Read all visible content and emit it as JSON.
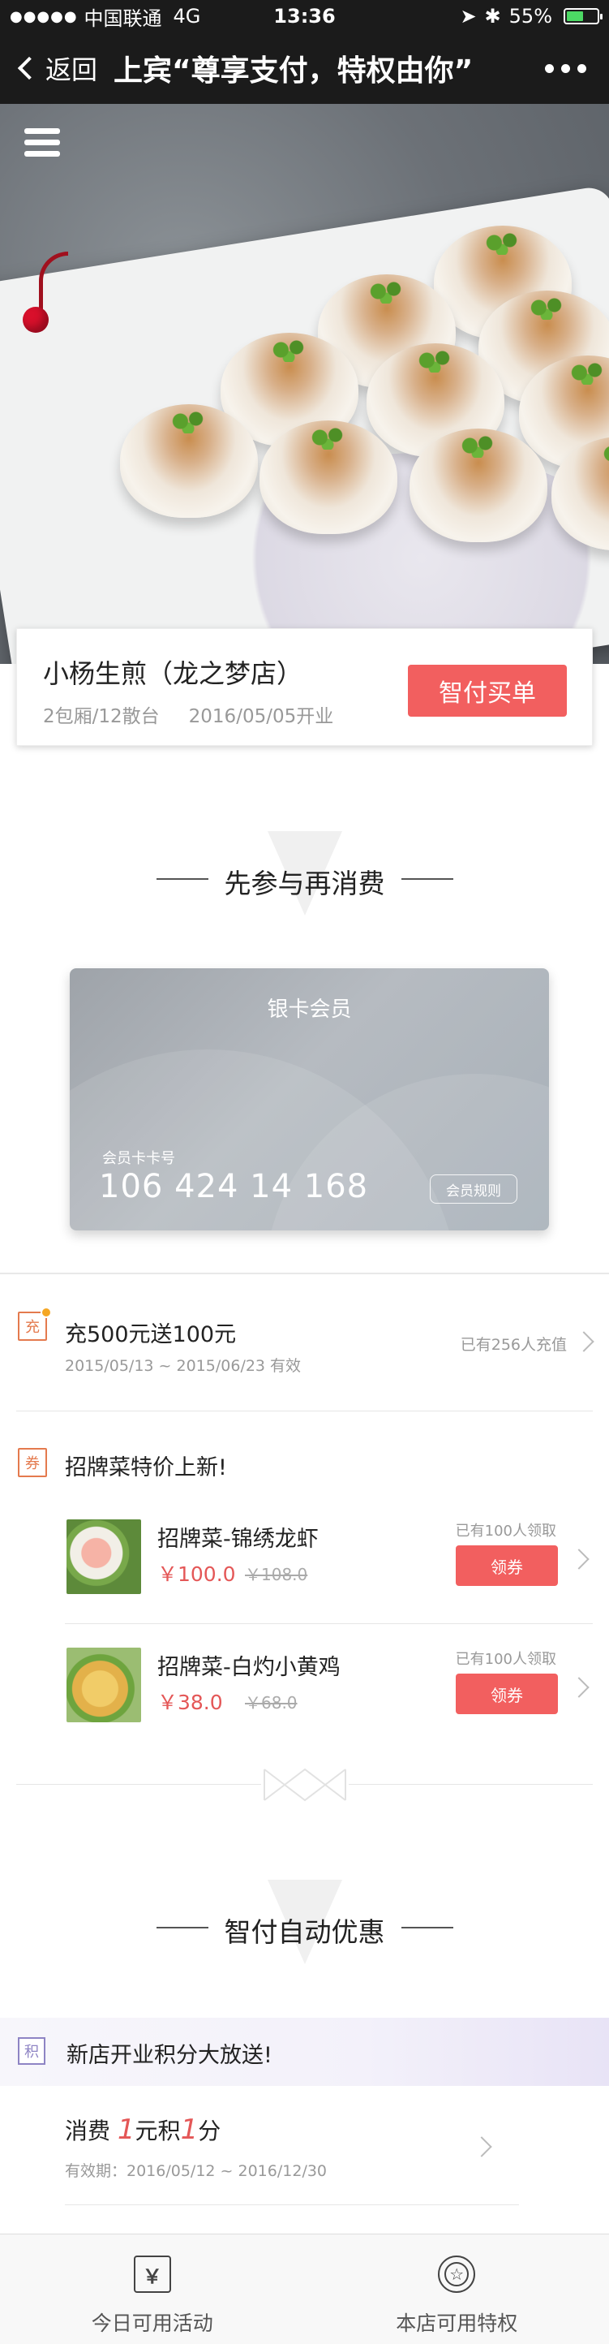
{
  "status_bar": {
    "signal": "●●●●●",
    "carrier": "中国联通",
    "network": "4G",
    "time": "13:36",
    "battery": "55%",
    "battery_level": 0.55
  },
  "nav": {
    "back_label": "返回",
    "title": "上宾“尊享支付，特权由你”"
  },
  "shop": {
    "name": "小杨生煎（龙之梦店）",
    "meta": "2包厢/12散台",
    "opened": "2016/05/05开业",
    "pay_button": "智付买单"
  },
  "section1": {
    "heading": "先参与再消费"
  },
  "member_card": {
    "title": "银卡会员",
    "number_label": "会员卡卡号",
    "number": "106 424 14 168",
    "rules_button": "会员规则"
  },
  "recharge": {
    "icon_char": "充",
    "title": "充500元送100元",
    "validity": "2015/05/13 ~ 2015/06/23 有效",
    "participants": "已有256人充值"
  },
  "coupons": {
    "icon_char": "券",
    "heading": "招牌菜特价上新!",
    "items": [
      {
        "title": "招牌菜-锦绣龙虾",
        "price": "￥100.0",
        "old_price": "￥108.0",
        "count": "已有100人领取",
        "button": "领券"
      },
      {
        "title": "招牌菜-白灼小黄鸡",
        "price": "￥38.0",
        "old_price": "￥68.0",
        "count": "已有100人领取",
        "button": "领券"
      }
    ]
  },
  "section2": {
    "heading": "智付自动优惠"
  },
  "points": {
    "icon_char": "积",
    "banner": "新店开业积分大放送!",
    "rule_prefix": "消费 ",
    "rule_num1": "1",
    "rule_mid": "元积",
    "rule_num2": "1",
    "rule_suffix": "分",
    "validity": "有效期：2016/05/12 ~ 2016/12/30"
  },
  "tabbar": {
    "tab1_icon": "￥",
    "tab1": "今日可用活动",
    "tab2": "本店可用特权",
    "tab2_icon": "☆"
  },
  "colors": {
    "accent_red": "#f25f5f",
    "price_red": "#e45757",
    "dark_bar": "#1b1b1b"
  }
}
